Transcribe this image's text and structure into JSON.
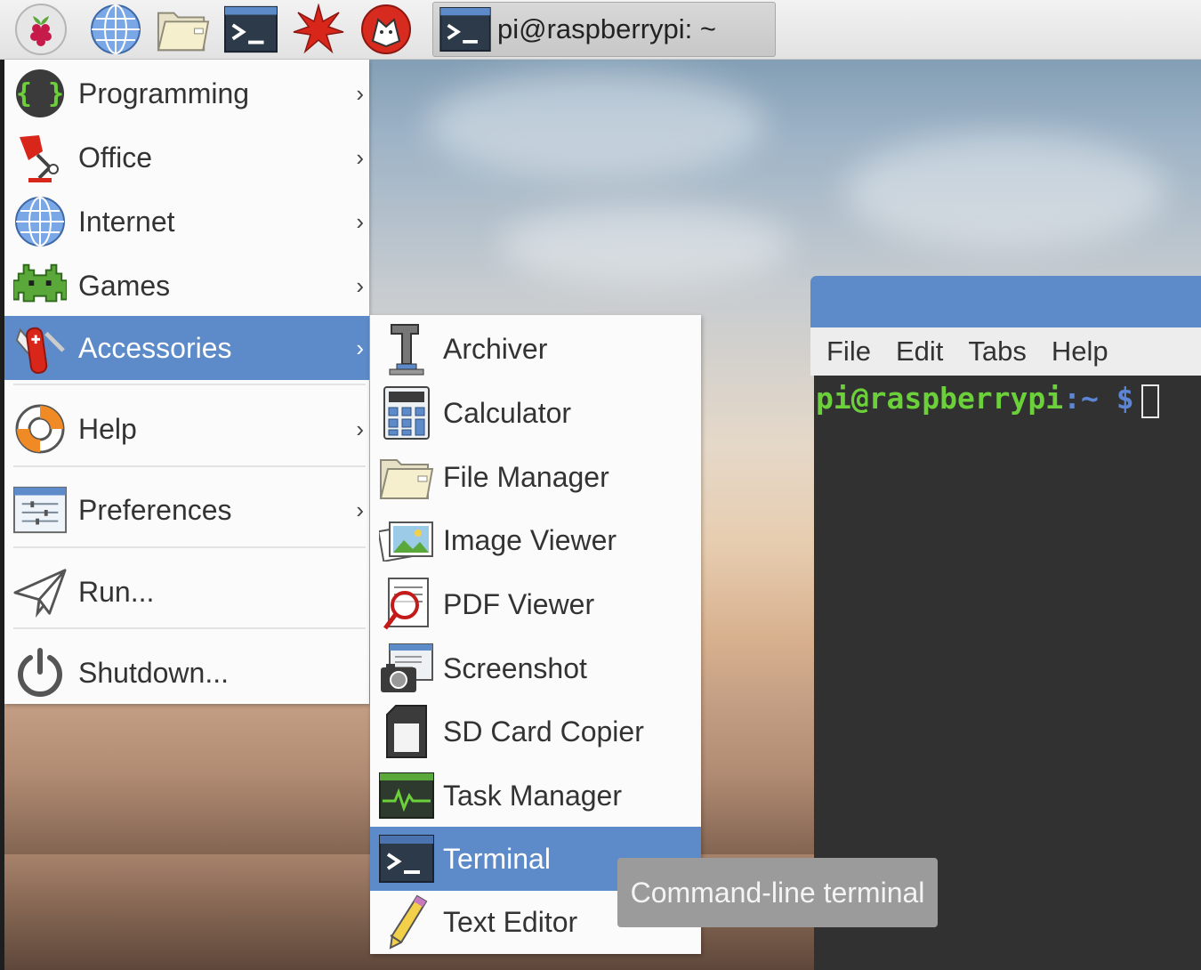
{
  "taskbar": {
    "launchers": [
      {
        "name": "raspberry-menu",
        "icon": "raspberry-icon"
      },
      {
        "name": "web-browser",
        "icon": "globe-icon"
      },
      {
        "name": "file-manager",
        "icon": "folder-icon"
      },
      {
        "name": "terminal",
        "icon": "terminal-icon"
      },
      {
        "name": "mathematica",
        "icon": "star-burst-icon"
      },
      {
        "name": "wolfram",
        "icon": "wolf-icon"
      }
    ],
    "window_button": {
      "title": "pi@raspberrypi: ~",
      "icon": "terminal-icon"
    }
  },
  "menu": {
    "items": [
      {
        "label": "Programming",
        "icon": "braces-icon",
        "has_submenu": true
      },
      {
        "label": "Office",
        "icon": "lamp-icon",
        "has_submenu": true
      },
      {
        "label": "Internet",
        "icon": "globe-icon",
        "has_submenu": true
      },
      {
        "label": "Games",
        "icon": "space-invader-icon",
        "has_submenu": true
      },
      {
        "label": "Accessories",
        "icon": "pocket-knife-icon",
        "has_submenu": true,
        "active": true
      },
      {
        "label": "Help",
        "icon": "lifebuoy-icon",
        "has_submenu": true
      },
      {
        "label": "Preferences",
        "icon": "sliders-icon",
        "has_submenu": true
      },
      {
        "label": "Run...",
        "icon": "paper-plane-icon",
        "has_submenu": false
      },
      {
        "label": "Shutdown...",
        "icon": "power-icon",
        "has_submenu": false
      }
    ],
    "arrow": "›"
  },
  "submenu": {
    "items": [
      {
        "label": "Archiver",
        "icon": "clamp-icon"
      },
      {
        "label": "Calculator",
        "icon": "calculator-icon"
      },
      {
        "label": "File Manager",
        "icon": "folder-icon"
      },
      {
        "label": "Image Viewer",
        "icon": "image-icon"
      },
      {
        "label": "PDF Viewer",
        "icon": "magnifier-document-icon"
      },
      {
        "label": "Screenshot",
        "icon": "camera-icon"
      },
      {
        "label": "SD Card Copier",
        "icon": "sd-card-icon"
      },
      {
        "label": "Task Manager",
        "icon": "activity-monitor-icon"
      },
      {
        "label": "Terminal",
        "icon": "terminal-icon",
        "active": true
      },
      {
        "label": "Text Editor",
        "icon": "pencil-icon"
      }
    ]
  },
  "terminal": {
    "menus": [
      "File",
      "Edit",
      "Tabs",
      "Help"
    ],
    "prompt_user": "pi@raspberrypi",
    "prompt_sep": ":",
    "prompt_path": "~ $",
    "colors": {
      "titlebar": "#5d8ac8",
      "background": "#303130",
      "user": "#6cd03a",
      "path": "#5c85d4"
    }
  },
  "tooltip": {
    "text": "Command-line terminal"
  },
  "colors": {
    "highlight": "#5d8ac8",
    "menu_bg": "#fbfbfb"
  }
}
